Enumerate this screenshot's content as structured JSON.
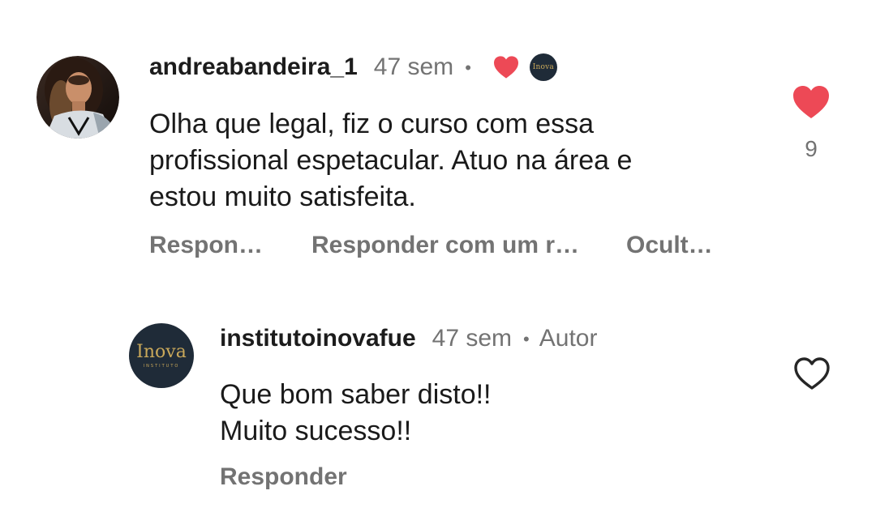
{
  "comments": [
    {
      "username": "andreabandeira_1",
      "time": "47 sem",
      "separator": "•",
      "creator_liked": true,
      "body": "Olha que legal, fiz o curso com essa\nprofissional espetacular. Atuo na área e\nestou muito satisfeita.",
      "actions": {
        "reply": "Respon…",
        "reply_with_reel": "Responder com um r…",
        "hide": "Ocult…"
      },
      "liked": true,
      "like_count": "9",
      "colors": {
        "heart": "#ed4956"
      }
    },
    {
      "username": "institutoinovafue",
      "time": "47 sem",
      "separator": "•",
      "author_tag": "Autor",
      "body": "Que bom saber disto!!\nMuito sucesso!!",
      "actions": {
        "reply": "Responder"
      },
      "liked": false,
      "colors": {
        "heart_outline": "#262626"
      }
    }
  ],
  "brand": {
    "logo_text": "Inova",
    "logo_subtext": "INSTITUTO",
    "colors": {
      "navy": "#1f2b38",
      "gold": "#c9a85a"
    }
  },
  "icons": {
    "creator_heart": "heart-filled-icon",
    "creator_badge": "creator-avatar-badge",
    "like_filled": "heart-filled-icon",
    "like_outline": "heart-outline-icon"
  }
}
